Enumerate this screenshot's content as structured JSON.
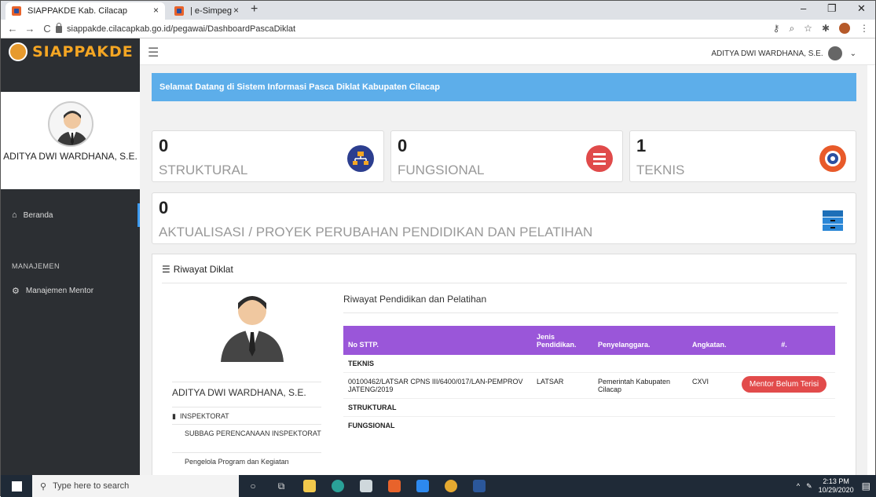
{
  "browser": {
    "tabs": [
      {
        "label": "SIAPPAKDE Kab. Cilacap"
      },
      {
        "label": "| e-Simpeg"
      }
    ],
    "url": "siappakde.cilacapkab.go.id/pegawai/DashboardPascaDiklat",
    "close_glyph": "×",
    "new_tab_glyph": "+",
    "back_glyph": "←",
    "forward_glyph": "→",
    "reload_glyph": "C",
    "minimize_glyph": "–",
    "restore_glyph": "❐",
    "close_window_glyph": "✕"
  },
  "app": {
    "logo_text": "SIAPPAKDE",
    "user_top": "ADITYA DWI WARDHANA, S.E.",
    "profile_name": "ADITYA DWI WARDHANA, S.E.",
    "welcome": "Selamat Datang di Sistem Informasi Pasca Diklat Kabupaten Cilacap"
  },
  "sidebar": {
    "beranda": "Beranda",
    "section": "MANAJEMEN",
    "mentor": "Manajemen Mentor"
  },
  "stats": [
    {
      "num": "0",
      "label": "STRUKTURAL",
      "color": "#2c3e8f"
    },
    {
      "num": "0",
      "label": "FUNGSIONAL",
      "color": "#e04a4a"
    },
    {
      "num": "1",
      "label": "TEKNIS",
      "color": "#e85a2a"
    }
  ],
  "wide_stat": {
    "num": "0",
    "label": "AKTUALISASI / PROYEK PERUBAHAN PENDIDIKAN DAN PELATIHAN",
    "color": "#2a86d6"
  },
  "riwayat": {
    "title": "Riwayat Diklat",
    "name": "ADITYA DWI WARDHANA, S.E.",
    "unit": "INSPEKTORAT",
    "subunit": "SUBBAG PERENCANAAN INSPEKTORAT",
    "position": "Pengelola Program dan Kegiatan",
    "table_title": "Riwayat Pendidikan dan Pelatihan",
    "headers": [
      "No STTP.",
      "Jenis Pendidikan.",
      "Penyelanggara.",
      "Angkatan.",
      "#."
    ],
    "group_teknis": "TEKNIS",
    "row": {
      "no": "00100462/LATSAR CPNS III/6400/017/LAN-PEMPROV JATENG/2019",
      "jenis": "LATSAR",
      "penyelenggara": "Pemerintah Kabupaten Cilacap",
      "angkatan": "CXVI",
      "action": "Mentor Belum Terisi"
    },
    "group_struktural": "STRUKTURAL",
    "group_fungsional": "FUNGSIONAL"
  },
  "taskbar": {
    "search": "Type here to search",
    "time": "2:13 PM",
    "date": "10/29/2020"
  }
}
